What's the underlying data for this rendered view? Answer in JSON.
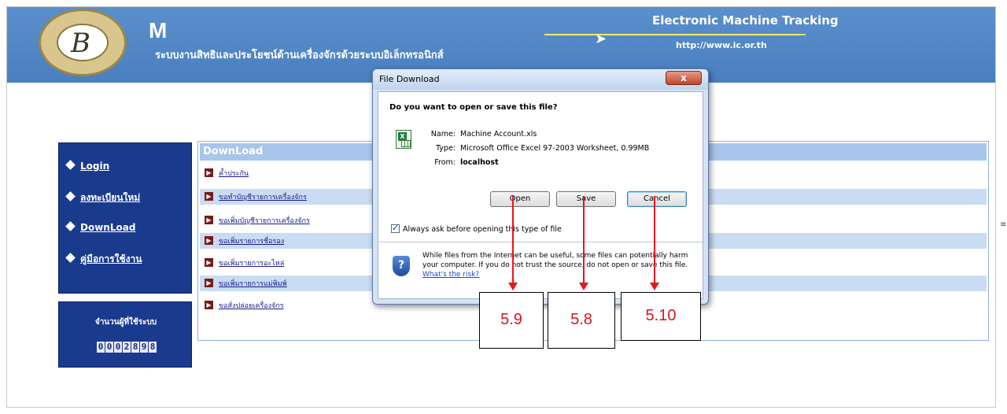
{
  "header": {
    "logo_mark": "M",
    "site_subtitle": "ระบบงานสิทธิและประโยชน์ด้านเครื่องจักรด้วยระบบอิเล็กทรอนิกส์",
    "brand_title": "Electronic Machine Tracking",
    "brand_url": "http://www.ic.or.th"
  },
  "nav": {
    "items": [
      {
        "label": "Login"
      },
      {
        "label": "ลงทะเบียนใหม่"
      },
      {
        "label": "DownLoad"
      },
      {
        "label": "คู่มือการใช้งาน"
      }
    ],
    "counter_label": "จำนวนผู้ที่ใช้ระบบ",
    "counter_digits": [
      "0",
      "0",
      "0",
      "2",
      "8",
      "9",
      "8"
    ]
  },
  "download": {
    "title": "DownLoad",
    "items": [
      "ค้ำประกัน",
      "ขอทำบัญชีรายการเครื่องจักร",
      "ขอเพิ่มบัญชีรายการเครื่องจักร",
      "ขอเพิ่มรายการชื่อรอง",
      "ขอเพิ่มรายการอะไหล่",
      "ขอเพิ่มรายการแม่พิมพ์",
      "ขอสั่งปล่อยเครื่องจักร"
    ]
  },
  "dialog": {
    "title": "File Download",
    "close_label": "x",
    "question": "Do you want to open or save this file?",
    "name_key": "Name:",
    "name_value": "Machine Account.xls",
    "type_key": "Type:",
    "type_value": "Microsoft Office Excel 97-2003 Worksheet, 0.99MB",
    "from_key": "From:",
    "from_value": "localhost",
    "buttons": {
      "open": "Open",
      "save": "Save",
      "cancel": "Cancel"
    },
    "always_ask": "Always ask before opening this type of file",
    "warning": "While files from the Internet can be useful, some files can potentially harm your computer. If you do not trust the source, do not open or save this file.",
    "risk_link": "What's the risk?"
  },
  "annotations": {
    "open": "5.9",
    "save": "5.8",
    "cancel": "5.10"
  },
  "colors": {
    "banner": "#4a7fc0",
    "nav": "#1a3a8e",
    "annotation_red": "#e8141e"
  }
}
